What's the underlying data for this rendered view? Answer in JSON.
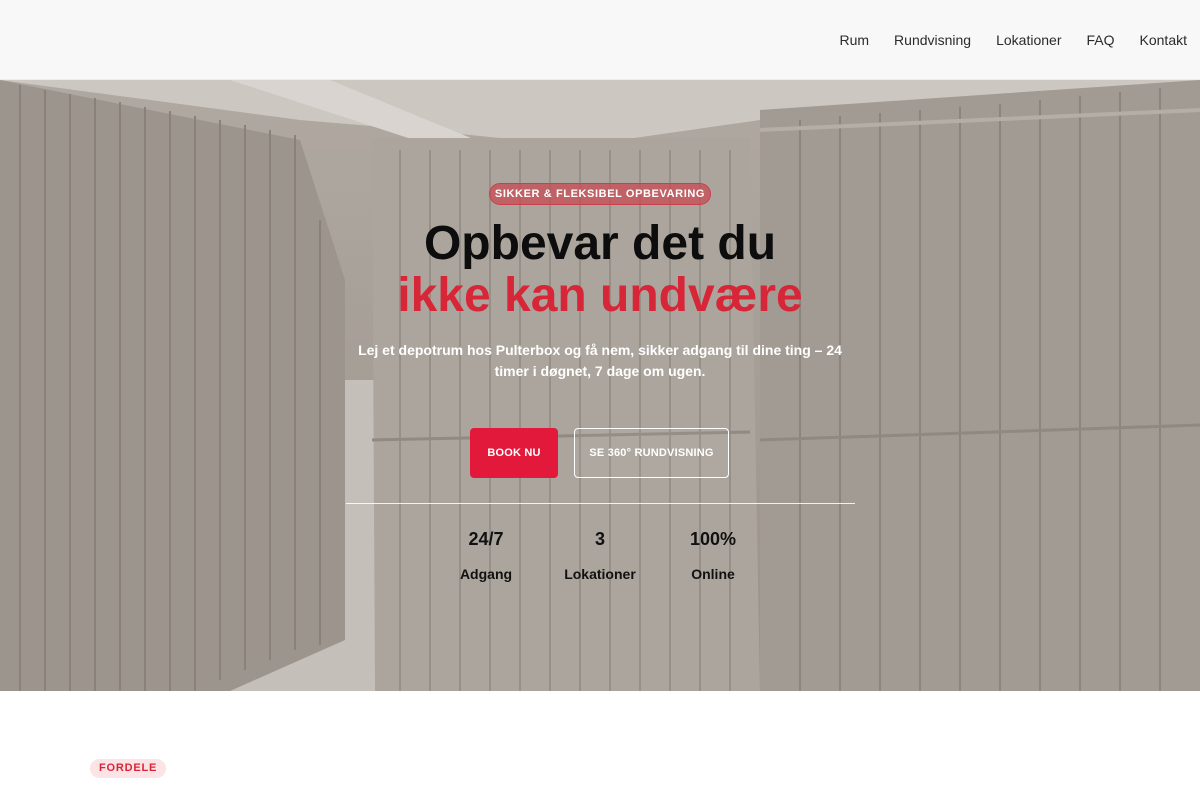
{
  "nav": {
    "items": [
      {
        "label": "Rum"
      },
      {
        "label": "Rundvisning"
      },
      {
        "label": "Lokationer"
      },
      {
        "label": "FAQ"
      },
      {
        "label": "Kontakt"
      }
    ]
  },
  "hero": {
    "badge": "SIKKER & FLEKSIBEL OPBEVARING",
    "title_line1": "Opbevar det du",
    "title_line2": "ikke kan undvære",
    "lead": "Lej et depotrum hos Pulterbox og få nem, sikker adgang til dine ting – 24 timer i døgnet, 7 dage om ugen.",
    "primary_button": "BOOK NU",
    "secondary_button": "SE 360° RUNDVISNING",
    "stats": [
      {
        "value": "24/7",
        "label": "Adgang"
      },
      {
        "value": "3",
        "label": "Lokationer"
      },
      {
        "value": "100%",
        "label": "Online"
      }
    ]
  },
  "section": {
    "tag": "FORDELE"
  },
  "colors": {
    "accent": "#e3193c",
    "accent_text": "#d72638",
    "header_bg": "#f8f8f8"
  }
}
